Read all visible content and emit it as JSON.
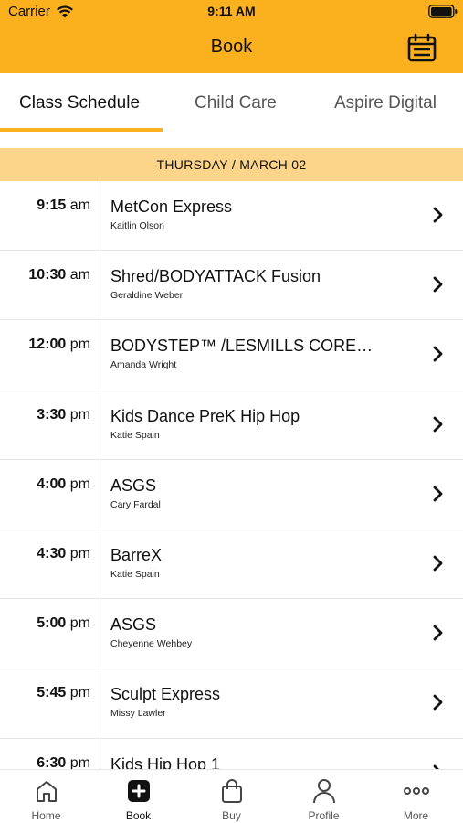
{
  "status_bar": {
    "carrier": "Carrier",
    "time": "9:11 AM"
  },
  "nav": {
    "title": "Book",
    "calendar_icon": "calendar-icon"
  },
  "tabs": [
    {
      "label": "Class Schedule",
      "active": true
    },
    {
      "label": "Child Care",
      "active": false
    },
    {
      "label": "Aspire Digital",
      "active": false
    }
  ],
  "date_header": "THURSDAY / MARCH 02",
  "classes": [
    {
      "time": "9:15",
      "ampm": "am",
      "name": "MetCon Express",
      "instructor": "Kaitlin Olson"
    },
    {
      "time": "10:30",
      "ampm": "am",
      "name": "Shred/BODYATTACK Fusion",
      "instructor": "Geraldine Weber"
    },
    {
      "time": "12:00",
      "ampm": "pm",
      "name": "BODYSTEP™ /LESMILLS CORE…",
      "instructor": "Amanda Wright"
    },
    {
      "time": "3:30",
      "ampm": "pm",
      "name": "Kids Dance PreK Hip Hop",
      "instructor": "Katie Spain"
    },
    {
      "time": "4:00",
      "ampm": "pm",
      "name": "ASGS",
      "instructor": "Cary Fardal"
    },
    {
      "time": "4:30",
      "ampm": "pm",
      "name": "BarreX",
      "instructor": "Katie Spain"
    },
    {
      "time": "5:00",
      "ampm": "pm",
      "name": "ASGS",
      "instructor": "Cheyenne Wehbey"
    },
    {
      "time": "5:45",
      "ampm": "pm",
      "name": "Sculpt Express",
      "instructor": "Missy Lawler"
    },
    {
      "time": "6:30",
      "ampm": "pm",
      "name": "Kids Hip Hop 1",
      "instructor": ""
    }
  ],
  "tabbar": [
    {
      "label": "Home",
      "icon": "home-icon",
      "active": false
    },
    {
      "label": "Book",
      "icon": "plus-square-icon",
      "active": true
    },
    {
      "label": "Buy",
      "icon": "shopping-bag-icon",
      "active": false
    },
    {
      "label": "Profile",
      "icon": "person-icon",
      "active": false
    },
    {
      "label": "More",
      "icon": "more-dots-icon",
      "active": false
    }
  ],
  "colors": {
    "brand": "#fbb11e",
    "date_header_bg": "#fcd58a"
  }
}
